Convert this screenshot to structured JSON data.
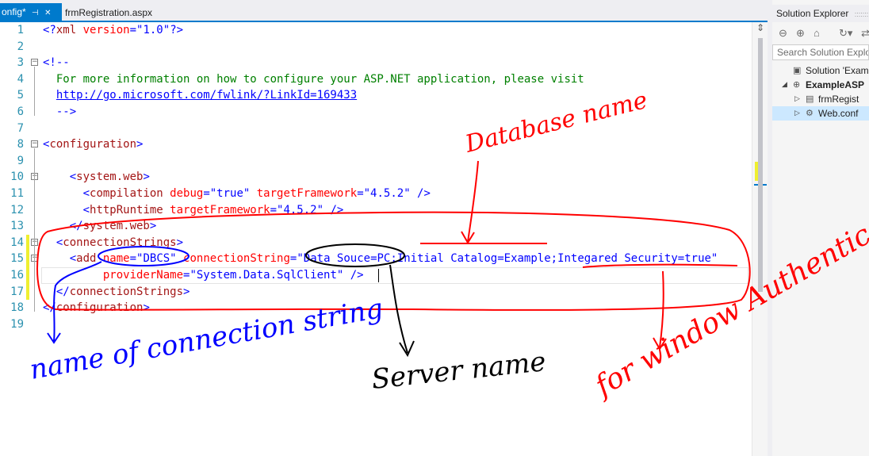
{
  "tabs": {
    "active_label": "onfig*",
    "pin_icon": "⊣",
    "close_icon": "✕",
    "inactive_label": "frmRegistration.aspx"
  },
  "lines": [
    {
      "n": "1",
      "fold": "",
      "parts": [
        {
          "t": "<?",
          "c": "blue"
        },
        {
          "t": "xml",
          "c": "brown"
        },
        {
          "t": " version",
          "c": "red"
        },
        {
          "t": "=\"",
          "c": "blue"
        },
        {
          "t": "1.0",
          "c": "blue"
        },
        {
          "t": "\"",
          "c": "blue"
        },
        {
          "t": "?>",
          "c": "blue"
        }
      ]
    },
    {
      "n": "2",
      "fold": "",
      "parts": []
    },
    {
      "n": "3",
      "fold": "−",
      "parts": [
        {
          "t": "<!--",
          "c": "blue"
        }
      ]
    },
    {
      "n": "4",
      "fold": "",
      "parts": [
        {
          "t": "  For more information on how to configure your ASP.NET application, please visit",
          "c": "green"
        }
      ]
    },
    {
      "n": "5",
      "fold": "",
      "parts": [
        {
          "t": "  ",
          "c": "green"
        },
        {
          "t": "http://go.microsoft.com/fwlink/?LinkId=169433",
          "c": "link"
        }
      ]
    },
    {
      "n": "6",
      "fold": "",
      "parts": [
        {
          "t": "  -->",
          "c": "blue"
        }
      ]
    },
    {
      "n": "7",
      "fold": "",
      "parts": []
    },
    {
      "n": "8",
      "fold": "−",
      "parts": [
        {
          "t": "<",
          "c": "blue"
        },
        {
          "t": "configuration",
          "c": "brown"
        },
        {
          "t": ">",
          "c": "blue"
        }
      ]
    },
    {
      "n": "9",
      "fold": "",
      "parts": []
    },
    {
      "n": "10",
      "fold": "−",
      "parts": [
        {
          "t": "    <",
          "c": "blue"
        },
        {
          "t": "system.web",
          "c": "brown"
        },
        {
          "t": ">",
          "c": "blue"
        }
      ]
    },
    {
      "n": "11",
      "fold": "",
      "parts": [
        {
          "t": "      <",
          "c": "blue"
        },
        {
          "t": "compilation",
          "c": "brown"
        },
        {
          "t": " debug",
          "c": "red"
        },
        {
          "t": "=\"true\"",
          "c": "blue"
        },
        {
          "t": " targetFramework",
          "c": "red"
        },
        {
          "t": "=\"4.5.2\"",
          "c": "blue"
        },
        {
          "t": " />",
          "c": "blue"
        }
      ]
    },
    {
      "n": "12",
      "fold": "",
      "parts": [
        {
          "t": "      <",
          "c": "blue"
        },
        {
          "t": "httpRuntime",
          "c": "brown"
        },
        {
          "t": " targetFramework",
          "c": "red"
        },
        {
          "t": "=\"4.5.2\"",
          "c": "blue"
        },
        {
          "t": " />",
          "c": "blue"
        }
      ]
    },
    {
      "n": "13",
      "fold": "",
      "parts": [
        {
          "t": "    </",
          "c": "blue"
        },
        {
          "t": "system.web",
          "c": "brown"
        },
        {
          "t": ">",
          "c": "blue"
        }
      ]
    },
    {
      "n": "14",
      "fold": "−",
      "parts": [
        {
          "t": "  <",
          "c": "blue"
        },
        {
          "t": "connectionStrings",
          "c": "brown"
        },
        {
          "t": ">",
          "c": "blue"
        }
      ]
    },
    {
      "n": "15",
      "fold": "−",
      "parts": [
        {
          "t": "    <",
          "c": "blue"
        },
        {
          "t": "add",
          "c": "brown"
        },
        {
          "t": " name",
          "c": "red"
        },
        {
          "t": "=\"DBCS\"",
          "c": "blue"
        },
        {
          "t": " connectionString",
          "c": "red"
        },
        {
          "t": "=\"Data Souce=PC;Initial Catalog=Example;Integared Security=true\"",
          "c": "blue"
        }
      ]
    },
    {
      "n": "16",
      "fold": "",
      "parts": [
        {
          "t": "         providerName",
          "c": "red"
        },
        {
          "t": "=\"System.Data.SqlClient\"",
          "c": "blue"
        },
        {
          "t": " />",
          "c": "blue"
        }
      ]
    },
    {
      "n": "17",
      "fold": "",
      "parts": [
        {
          "t": "  </",
          "c": "blue"
        },
        {
          "t": "connectionStrings",
          "c": "brown"
        },
        {
          "t": ">",
          "c": "blue"
        }
      ]
    },
    {
      "n": "18",
      "fold": "",
      "parts": [
        {
          "t": "</",
          "c": "blue"
        },
        {
          "t": "configuration",
          "c": "brown"
        },
        {
          "t": ">",
          "c": "blue"
        }
      ]
    },
    {
      "n": "19",
      "fold": "",
      "parts": []
    }
  ],
  "solution_explorer": {
    "title": "Solution Explorer",
    "title_dots": ":::::::",
    "toolbar_icons": [
      "back-icon",
      "forward-icon",
      "home-icon",
      "history-icon",
      "sync-icon"
    ],
    "toolbar_glyphs": [
      "⊖",
      "⊕",
      "⌂",
      "↻▾",
      "⇄"
    ],
    "search_placeholder": "Search Solution Explor",
    "items": [
      {
        "label": "Solution 'Exampl",
        "icon": "▣",
        "expander": "",
        "bold": false,
        "selected": false,
        "level": 0
      },
      {
        "label": "ExampleASP",
        "icon": "⊕",
        "expander": "◢",
        "bold": true,
        "selected": false,
        "level": 0
      },
      {
        "label": "frmRegist",
        "icon": "▤",
        "expander": "▷",
        "bold": false,
        "selected": false,
        "level": 1
      },
      {
        "label": "Web.conf",
        "icon": "⚙",
        "expander": "▷",
        "bold": false,
        "selected": true,
        "level": 1
      }
    ]
  },
  "annotations": {
    "database_name": "Database name",
    "name_of_connection_string": "name of connection string",
    "server_name": "Server name",
    "for_window_authentication": "for window Authentica"
  },
  "colors": {
    "accent": "#007acc",
    "line_number": "#2b91af",
    "xml_tag": "#a31515",
    "xml_attr": "#ff0000",
    "xml_value": "#0000ff",
    "comment": "#008000",
    "annotation_red": "#ff0000",
    "annotation_blue": "#0000ff",
    "annotation_black": "#000000"
  }
}
